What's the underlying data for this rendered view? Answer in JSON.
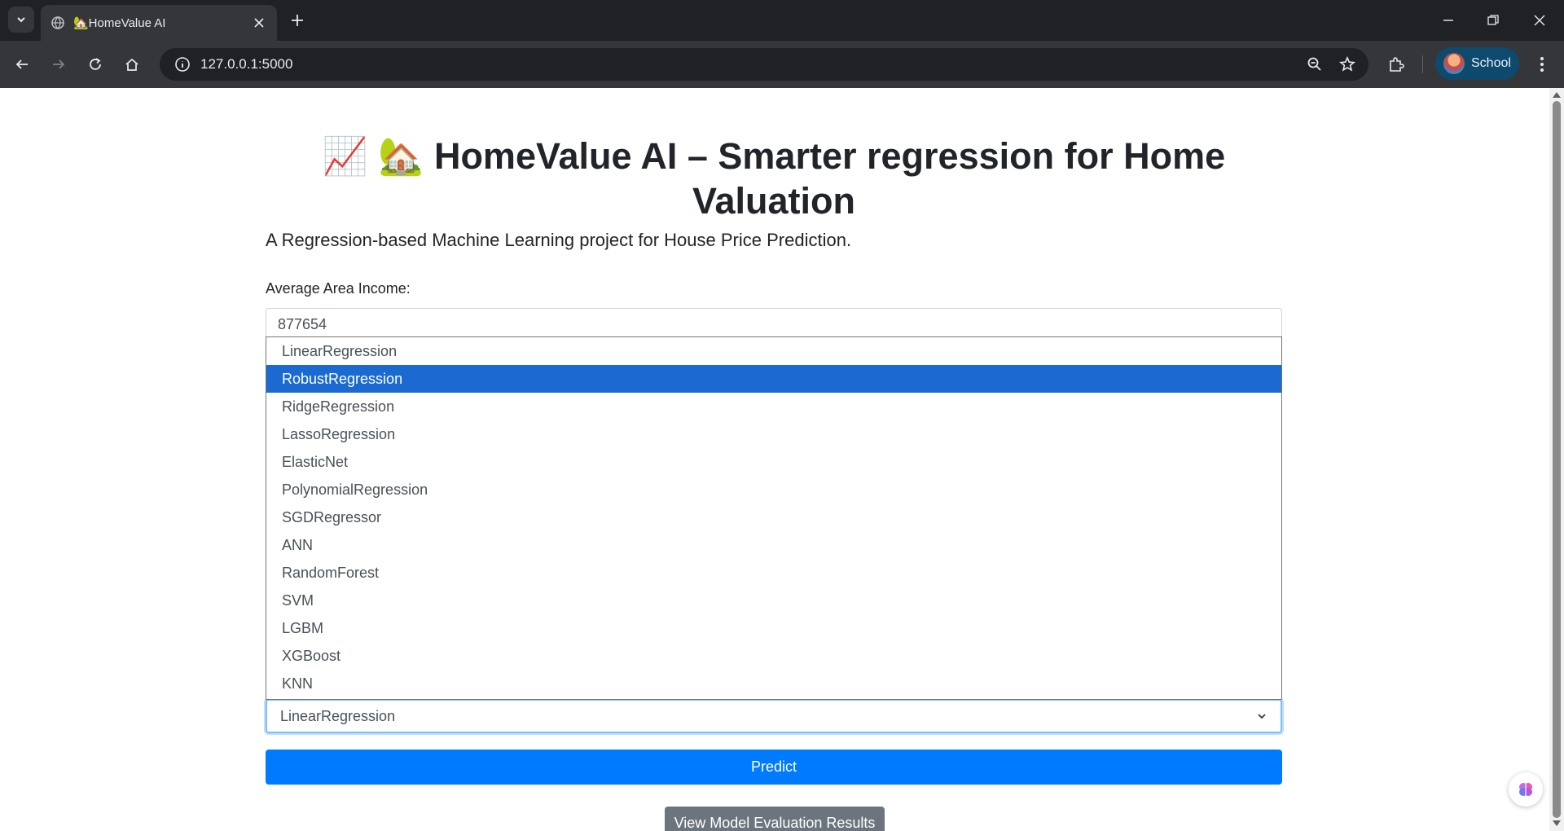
{
  "browser": {
    "tab_title": "🏡HomeValue AI",
    "url": "127.0.0.1:5000",
    "profile_label": "School"
  },
  "page": {
    "title": "📈 🏡 HomeValue AI – Smarter regression for Home Valuation",
    "subtitle": "A Regression-based Machine Learning project for House Price Prediction.",
    "income_label": "Average Area Income:",
    "income_value": "877654",
    "model_options": [
      "LinearRegression",
      "RobustRegression",
      "RidgeRegression",
      "LassoRegression",
      "ElasticNet",
      "PolynomialRegression",
      "SGDRegressor",
      "ANN",
      "RandomForest",
      "SVM",
      "LGBM",
      "XGBoost",
      "KNN"
    ],
    "highlighted_option": "RobustRegression",
    "selected_model": "LinearRegression",
    "predict_label": "Predict",
    "eval_label": "View Model Evaluation Results"
  },
  "colors": {
    "chrome_dark": "#202124",
    "chrome_toolbar": "#35363a",
    "primary": "#007bff",
    "option_highlight": "#1a6ad1",
    "secondary": "#6c757d"
  }
}
